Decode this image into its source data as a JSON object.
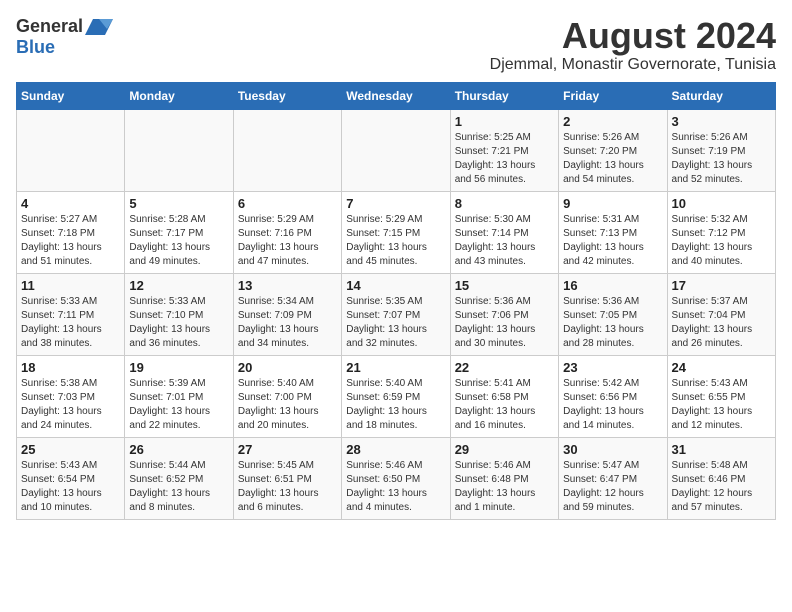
{
  "header": {
    "logo_general": "General",
    "logo_blue": "Blue",
    "title": "August 2024",
    "subtitle": "Djemmal, Monastir Governorate, Tunisia"
  },
  "days_of_week": [
    "Sunday",
    "Monday",
    "Tuesday",
    "Wednesday",
    "Thursday",
    "Friday",
    "Saturday"
  ],
  "weeks": [
    [
      {
        "day": "",
        "sunrise": "",
        "sunset": "",
        "daylight": ""
      },
      {
        "day": "",
        "sunrise": "",
        "sunset": "",
        "daylight": ""
      },
      {
        "day": "",
        "sunrise": "",
        "sunset": "",
        "daylight": ""
      },
      {
        "day": "",
        "sunrise": "",
        "sunset": "",
        "daylight": ""
      },
      {
        "day": "1",
        "sunrise": "Sunrise: 5:25 AM",
        "sunset": "Sunset: 7:21 PM",
        "daylight": "Daylight: 13 hours and 56 minutes."
      },
      {
        "day": "2",
        "sunrise": "Sunrise: 5:26 AM",
        "sunset": "Sunset: 7:20 PM",
        "daylight": "Daylight: 13 hours and 54 minutes."
      },
      {
        "day": "3",
        "sunrise": "Sunrise: 5:26 AM",
        "sunset": "Sunset: 7:19 PM",
        "daylight": "Daylight: 13 hours and 52 minutes."
      }
    ],
    [
      {
        "day": "4",
        "sunrise": "Sunrise: 5:27 AM",
        "sunset": "Sunset: 7:18 PM",
        "daylight": "Daylight: 13 hours and 51 minutes."
      },
      {
        "day": "5",
        "sunrise": "Sunrise: 5:28 AM",
        "sunset": "Sunset: 7:17 PM",
        "daylight": "Daylight: 13 hours and 49 minutes."
      },
      {
        "day": "6",
        "sunrise": "Sunrise: 5:29 AM",
        "sunset": "Sunset: 7:16 PM",
        "daylight": "Daylight: 13 hours and 47 minutes."
      },
      {
        "day": "7",
        "sunrise": "Sunrise: 5:29 AM",
        "sunset": "Sunset: 7:15 PM",
        "daylight": "Daylight: 13 hours and 45 minutes."
      },
      {
        "day": "8",
        "sunrise": "Sunrise: 5:30 AM",
        "sunset": "Sunset: 7:14 PM",
        "daylight": "Daylight: 13 hours and 43 minutes."
      },
      {
        "day": "9",
        "sunrise": "Sunrise: 5:31 AM",
        "sunset": "Sunset: 7:13 PM",
        "daylight": "Daylight: 13 hours and 42 minutes."
      },
      {
        "day": "10",
        "sunrise": "Sunrise: 5:32 AM",
        "sunset": "Sunset: 7:12 PM",
        "daylight": "Daylight: 13 hours and 40 minutes."
      }
    ],
    [
      {
        "day": "11",
        "sunrise": "Sunrise: 5:33 AM",
        "sunset": "Sunset: 7:11 PM",
        "daylight": "Daylight: 13 hours and 38 minutes."
      },
      {
        "day": "12",
        "sunrise": "Sunrise: 5:33 AM",
        "sunset": "Sunset: 7:10 PM",
        "daylight": "Daylight: 13 hours and 36 minutes."
      },
      {
        "day": "13",
        "sunrise": "Sunrise: 5:34 AM",
        "sunset": "Sunset: 7:09 PM",
        "daylight": "Daylight: 13 hours and 34 minutes."
      },
      {
        "day": "14",
        "sunrise": "Sunrise: 5:35 AM",
        "sunset": "Sunset: 7:07 PM",
        "daylight": "Daylight: 13 hours and 32 minutes."
      },
      {
        "day": "15",
        "sunrise": "Sunrise: 5:36 AM",
        "sunset": "Sunset: 7:06 PM",
        "daylight": "Daylight: 13 hours and 30 minutes."
      },
      {
        "day": "16",
        "sunrise": "Sunrise: 5:36 AM",
        "sunset": "Sunset: 7:05 PM",
        "daylight": "Daylight: 13 hours and 28 minutes."
      },
      {
        "day": "17",
        "sunrise": "Sunrise: 5:37 AM",
        "sunset": "Sunset: 7:04 PM",
        "daylight": "Daylight: 13 hours and 26 minutes."
      }
    ],
    [
      {
        "day": "18",
        "sunrise": "Sunrise: 5:38 AM",
        "sunset": "Sunset: 7:03 PM",
        "daylight": "Daylight: 13 hours and 24 minutes."
      },
      {
        "day": "19",
        "sunrise": "Sunrise: 5:39 AM",
        "sunset": "Sunset: 7:01 PM",
        "daylight": "Daylight: 13 hours and 22 minutes."
      },
      {
        "day": "20",
        "sunrise": "Sunrise: 5:40 AM",
        "sunset": "Sunset: 7:00 PM",
        "daylight": "Daylight: 13 hours and 20 minutes."
      },
      {
        "day": "21",
        "sunrise": "Sunrise: 5:40 AM",
        "sunset": "Sunset: 6:59 PM",
        "daylight": "Daylight: 13 hours and 18 minutes."
      },
      {
        "day": "22",
        "sunrise": "Sunrise: 5:41 AM",
        "sunset": "Sunset: 6:58 PM",
        "daylight": "Daylight: 13 hours and 16 minutes."
      },
      {
        "day": "23",
        "sunrise": "Sunrise: 5:42 AM",
        "sunset": "Sunset: 6:56 PM",
        "daylight": "Daylight: 13 hours and 14 minutes."
      },
      {
        "day": "24",
        "sunrise": "Sunrise: 5:43 AM",
        "sunset": "Sunset: 6:55 PM",
        "daylight": "Daylight: 13 hours and 12 minutes."
      }
    ],
    [
      {
        "day": "25",
        "sunrise": "Sunrise: 5:43 AM",
        "sunset": "Sunset: 6:54 PM",
        "daylight": "Daylight: 13 hours and 10 minutes."
      },
      {
        "day": "26",
        "sunrise": "Sunrise: 5:44 AM",
        "sunset": "Sunset: 6:52 PM",
        "daylight": "Daylight: 13 hours and 8 minutes."
      },
      {
        "day": "27",
        "sunrise": "Sunrise: 5:45 AM",
        "sunset": "Sunset: 6:51 PM",
        "daylight": "Daylight: 13 hours and 6 minutes."
      },
      {
        "day": "28",
        "sunrise": "Sunrise: 5:46 AM",
        "sunset": "Sunset: 6:50 PM",
        "daylight": "Daylight: 13 hours and 4 minutes."
      },
      {
        "day": "29",
        "sunrise": "Sunrise: 5:46 AM",
        "sunset": "Sunset: 6:48 PM",
        "daylight": "Daylight: 13 hours and 1 minute."
      },
      {
        "day": "30",
        "sunrise": "Sunrise: 5:47 AM",
        "sunset": "Sunset: 6:47 PM",
        "daylight": "Daylight: 12 hours and 59 minutes."
      },
      {
        "day": "31",
        "sunrise": "Sunrise: 5:48 AM",
        "sunset": "Sunset: 6:46 PM",
        "daylight": "Daylight: 12 hours and 57 minutes."
      }
    ]
  ]
}
